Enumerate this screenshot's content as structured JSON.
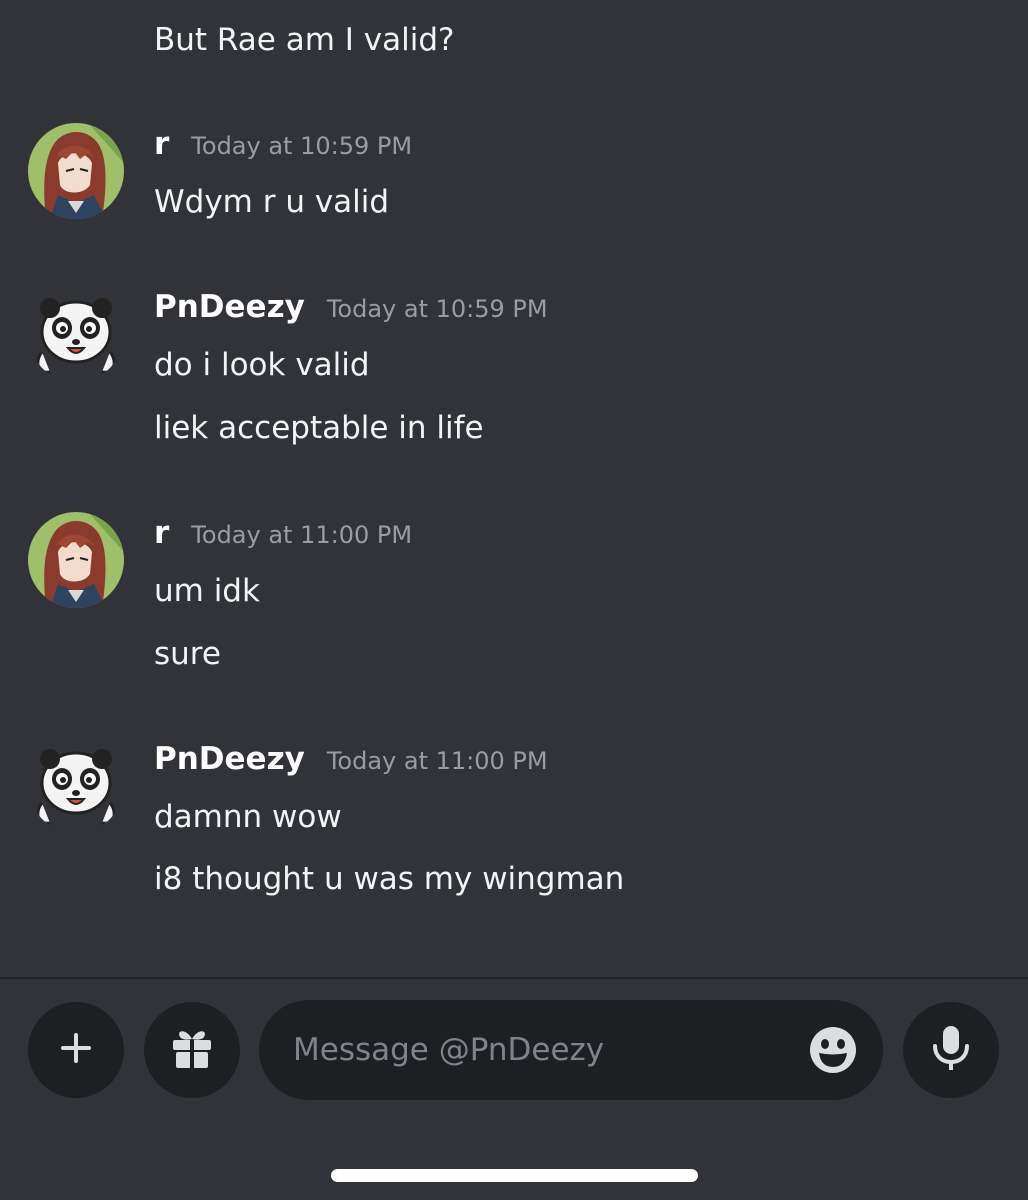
{
  "messages": {
    "m0": {
      "lines": [
        "But Rae am I valid?"
      ]
    },
    "m1": {
      "username": "r",
      "timestamp": "Today at 10:59 PM",
      "lines": [
        "Wdym r u valid"
      ],
      "avatar": "anime-girl-avatar"
    },
    "m2": {
      "username": "PnDeezy",
      "timestamp": "Today at 10:59 PM",
      "lines": [
        "do i look valid",
        "liek acceptable in life"
      ],
      "avatar": "panda-avatar"
    },
    "m3": {
      "username": "r",
      "timestamp": "Today at 11:00 PM",
      "lines": [
        "um idk",
        "sure"
      ],
      "avatar": "anime-girl-avatar"
    },
    "m4": {
      "username": "PnDeezy",
      "timestamp": "Today at 11:00 PM",
      "lines": [
        "damnn wow",
        "i8 thought u was my wingman"
      ],
      "avatar": "panda-avatar"
    }
  },
  "composer": {
    "placeholder": "Message @PnDeezy",
    "add_icon": "plus-icon",
    "gift_icon": "gift-icon",
    "emoji_icon": "emoji-icon",
    "mic_icon": "microphone-icon"
  },
  "colors": {
    "background": "#313338",
    "input_background": "#1e1f22",
    "text": "#f2f3f5",
    "muted": "#9a9ca4"
  }
}
